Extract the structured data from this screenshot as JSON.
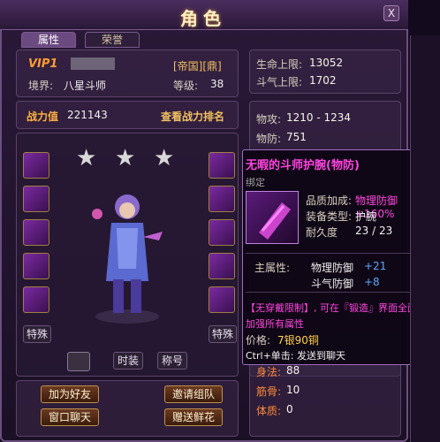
{
  "window": {
    "title": "角色",
    "close_label": "X"
  },
  "tabs": [
    {
      "label": "属性"
    },
    {
      "label": "荣誉"
    }
  ],
  "profile": {
    "vip": "VIP1",
    "server_tags": "[帝国][鼎]",
    "realm_label": "境界:",
    "realm_value": "八星斗师",
    "level_label": "等级:",
    "level_value": "38"
  },
  "combat": {
    "label": "战力值",
    "value": "221143",
    "rank_link": "查看战力排名"
  },
  "stars": [
    "★",
    "★",
    "★"
  ],
  "left_slots_label": "特殊",
  "right_slots_label": "特殊",
  "bottom_tabs": {
    "fashion": "时装",
    "title": "称号"
  },
  "action_buttons": {
    "add_friend": "加为好友",
    "invite_team": "邀请组队",
    "private_chat": "窗口聊天",
    "gift_flowers": "赠送鲜花"
  },
  "stats": {
    "hp_label": "生命上限:",
    "hp_value": "13052",
    "dq_label": "斗气上限:",
    "dq_value": "1702",
    "patk_label": "物攻:",
    "patk_value": "1210 - 1234",
    "pdef_label": "物防:",
    "pdef_value": "751",
    "body_label": "身法:",
    "body_value": "88",
    "bone_label": "筋骨:",
    "bone_value": "10",
    "con_label": "体质:",
    "con_value": "0"
  },
  "tooltip": {
    "name": "无暇的斗师护腕(物防)",
    "bound": "绑定",
    "quality_label": "品质加成:",
    "quality_value": "物理防御 +160%",
    "type_label": "装备类型:",
    "type_value": "护腕",
    "dur_label": "耐久度",
    "dur_value": "23 / 23",
    "main_attr_label": "主属性:",
    "attr1_name": "物理防御",
    "attr1_value": "+21",
    "attr2_name": "斗气防御",
    "attr2_value": "+8",
    "note_line1": "【无穿戴限制】, 可在『锻造』界面全面",
    "note_line2": "加强所有属性",
    "price_label": "价格:",
    "price_value": "7银90铜",
    "hint": "Ctrl+单击: 发送到聊天"
  },
  "colors": {
    "accent_purple": "#ff44e0",
    "gold": "#f0c060",
    "blue": "#5aa8ff"
  }
}
